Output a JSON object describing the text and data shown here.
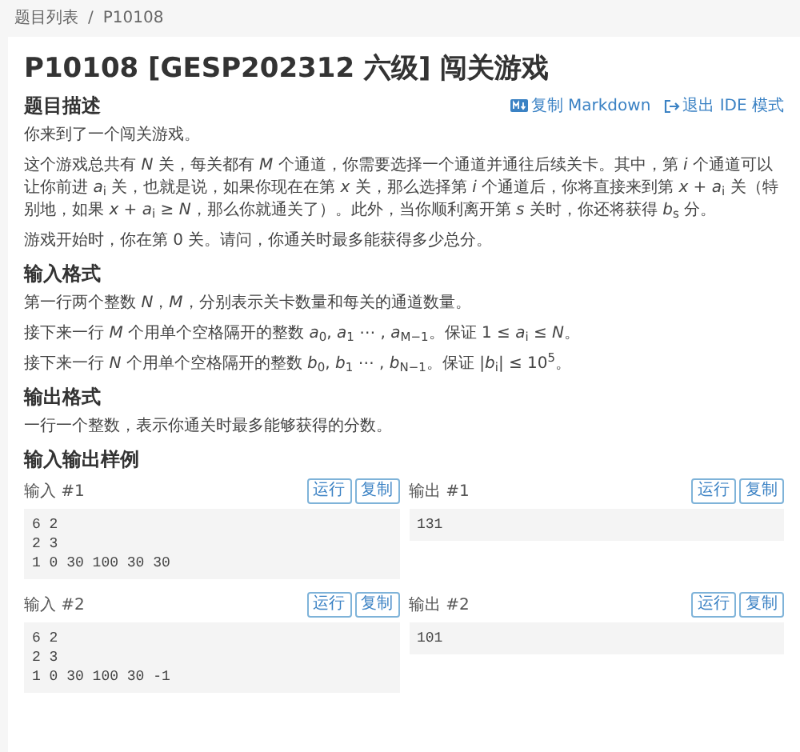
{
  "breadcrumb": {
    "items": [
      "题目列表",
      "P10108"
    ],
    "separator": "/"
  },
  "title": "P10108 [GESP202312 六级] 闯关游戏",
  "actions": [
    {
      "kind": "markdown",
      "label": "复制 Markdown"
    },
    {
      "kind": "exit",
      "label": "退出 IDE 模式"
    }
  ],
  "sections": [
    {
      "heading": "题目描述",
      "paragraphs": [
        "你来到了一个闯关游戏。",
        "这个游戏总共有 *N* 关，每关都有 *M* 个通道，你需要选择一个通道并通往后续关卡。其中，第 *i* 个通道可以让你前进 *a*$_{i}$ 关，也就是说，如果你现在在第 *x* 关，那么选择第 *i* 个通道后，你将直接来到第 *x* + *a*$_{i}$ 关（特别地，如果 *x* + *a*$_{i}$ ≥ *N*，那么你就通关了）。此外，当你顺利离开第 *s* 关时，你还将获得 *b*$_{s}$ 分。",
        "游戏开始时，你在第 0 关。请问，你通关时最多能获得多少总分。"
      ]
    },
    {
      "heading": "输入格式",
      "paragraphs": [
        "第一行两个整数 *N*，*M*，分别表示关卡数量和每关的通道数量。",
        "接下来一行 *M* 个用单个空格隔开的整数 *a*$_{0}$, *a*$_{1}$ ⋯ , *a*$_{M−1}$。保证 1 ≤ *a*$_{i}$ ≤ *N*。",
        "接下来一行 *N* 个用单个空格隔开的整数 *b*$_{0}$, *b*$_{1}$ ⋯ , *b*$_{N−1}$。保证 |*b*$_{i}$| ≤ 10$^{5}$。"
      ]
    },
    {
      "heading": "输出格式",
      "paragraphs": [
        "一行一个整数，表示你通关时最多能够获得的分数。"
      ]
    }
  ],
  "samples_heading": "输入输出样例",
  "samples": [
    {
      "input_label": "输入 #1",
      "input_buttons": [
        "运行",
        "复制"
      ],
      "input": "6 2\n2 3\n1 0 30 100 30 30",
      "output_label": "输出 #1",
      "output_buttons": [
        "运行",
        "复制"
      ],
      "output": "131"
    },
    {
      "input_label": "输入 #2",
      "input_buttons": [
        "运行",
        "复制"
      ],
      "input": "6 2\n2 3\n1 0 30 100 30 -1",
      "output_label": "输出 #2",
      "output_buttons": [
        "运行",
        "复制"
      ],
      "output": "101"
    }
  ]
}
